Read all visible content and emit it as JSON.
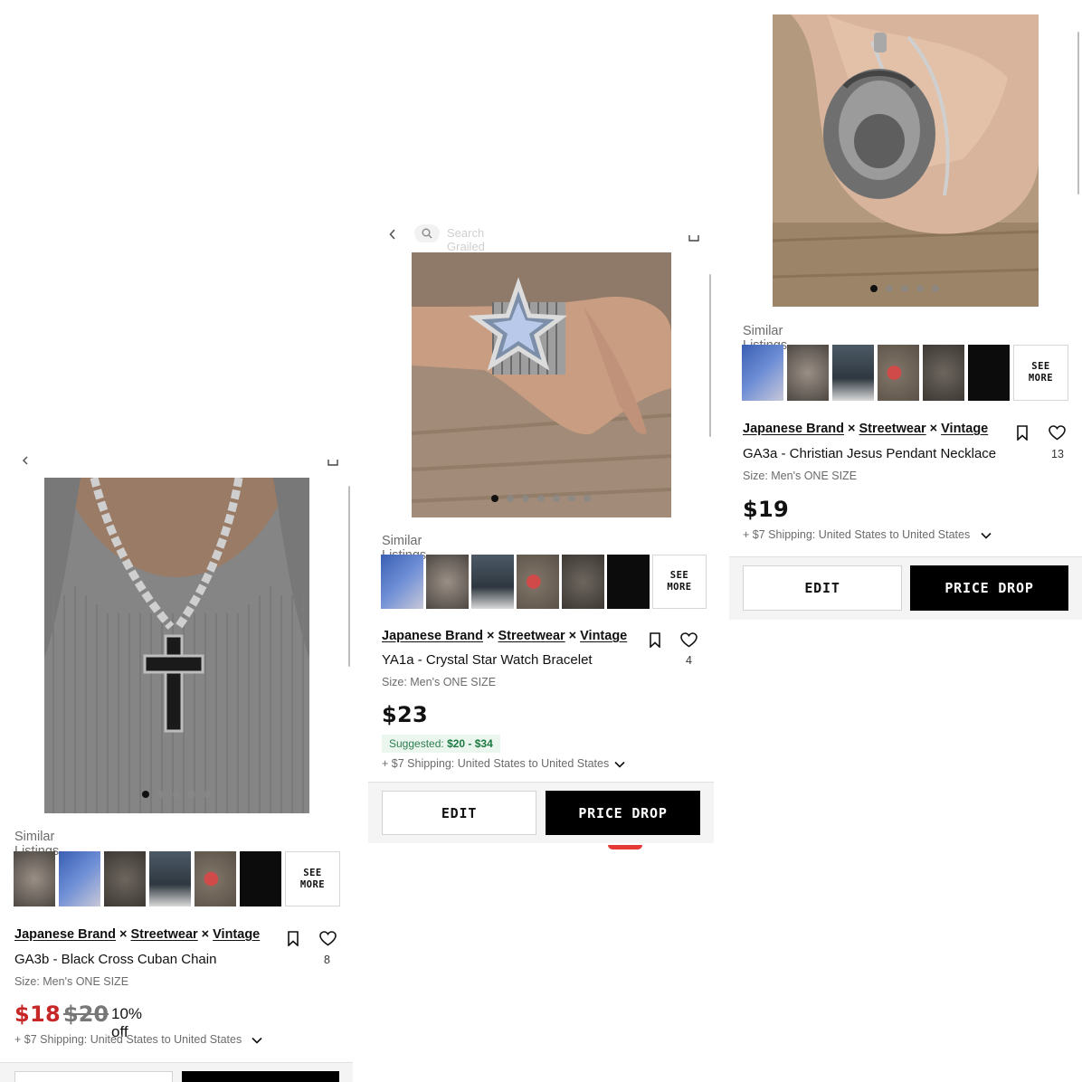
{
  "colors": {
    "sale": "#c62828",
    "suggested_bg": "#eaf6ee",
    "suggested_text": "#1b7a3f",
    "black": "#000000"
  },
  "common": {
    "similar_title": "Similar Listings",
    "see_more": "SEE\nMORE",
    "designers": [
      "Japanese Brand",
      "Streetwear",
      "Vintage"
    ],
    "designer_sep": "×",
    "size": "Size: Men's ONE SIZE",
    "shipping": "+ $7 Shipping: United States to United States",
    "edit_label": "EDIT",
    "price_drop_label": "PRICE DROP"
  },
  "listings": [
    {
      "title": "GA3b - Black Cross Cuban Chain",
      "price": "$18",
      "old_price": "$20",
      "discount": "10% off",
      "likes": "8",
      "photo_pages": 5,
      "photo_active_index": 0
    },
    {
      "title": "YA1a - Crystal Star Watch Bracelet",
      "price": "$23",
      "suggested_label": "Suggested:",
      "suggested_range": "$20 - $34",
      "likes": "4",
      "search_placeholder": "Search Grailed",
      "photo_pages": 7,
      "photo_active_index": 0
    },
    {
      "title": "GA3a - Christian Jesus Pendant Necklace",
      "price": "$19",
      "likes": "13",
      "photo_pages": 5,
      "photo_active_index": 0
    }
  ],
  "icons": [
    "bookmark-icon",
    "heart-icon",
    "chevron-down-icon",
    "back-arrow-icon",
    "search-icon",
    "share-icon"
  ]
}
